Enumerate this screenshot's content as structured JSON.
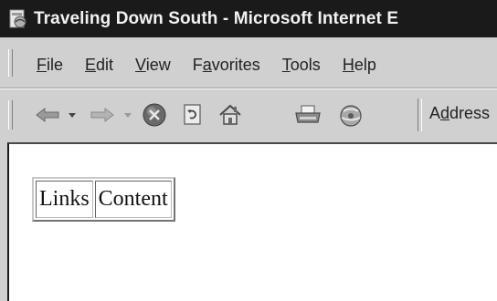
{
  "window": {
    "title": "Traveling Down South - Microsoft Internet E"
  },
  "menu": {
    "items": [
      {
        "pre": "",
        "key": "F",
        "post": "ile"
      },
      {
        "pre": "",
        "key": "E",
        "post": "dit"
      },
      {
        "pre": "",
        "key": "V",
        "post": "iew"
      },
      {
        "pre": "F",
        "key": "a",
        "post": "vorites"
      },
      {
        "pre": "",
        "key": "T",
        "post": "ools"
      },
      {
        "pre": "",
        "key": "H",
        "post": "elp"
      }
    ]
  },
  "toolbar": {
    "buttons": [
      "back-icon",
      "back-dropdown-icon",
      "forward-icon",
      "forward-dropdown-icon",
      "stop-icon",
      "refresh-icon",
      "home-icon",
      "print-icon",
      "media-icon"
    ],
    "address": {
      "pre": "A",
      "key": "d",
      "post": "dress"
    }
  },
  "page": {
    "cells": [
      "Links",
      "Content"
    ]
  }
}
